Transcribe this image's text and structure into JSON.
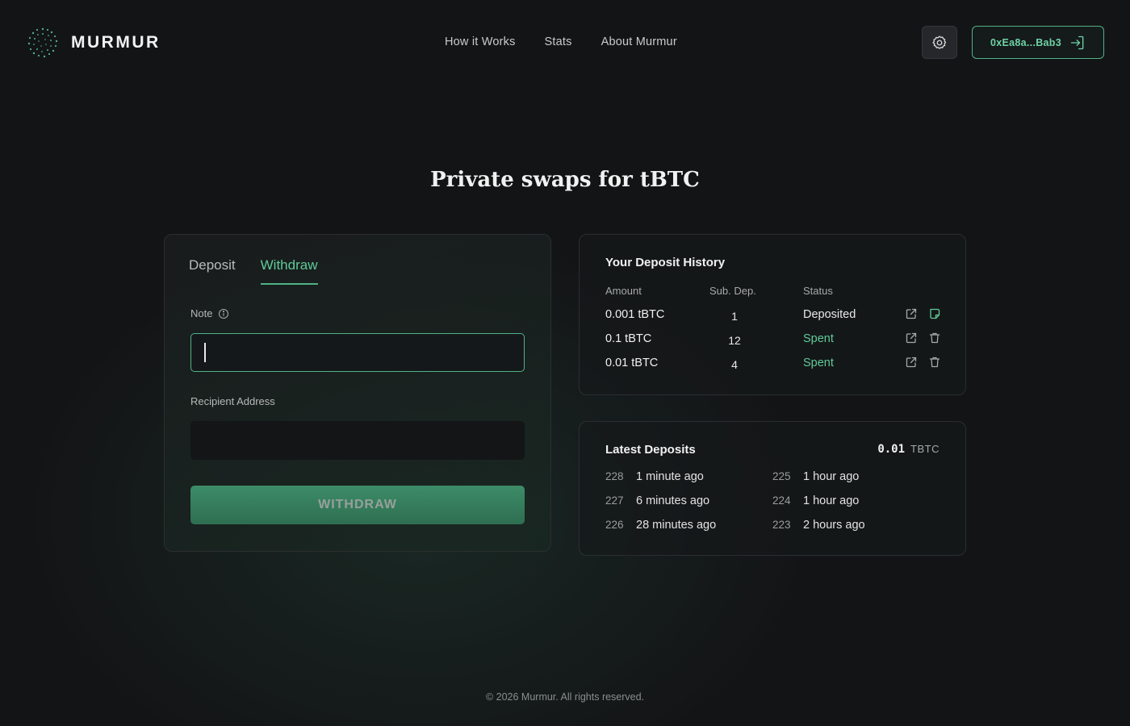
{
  "brand": {
    "name": "MURMUR"
  },
  "nav": {
    "items": [
      "How it Works",
      "Stats",
      "About Murmur"
    ]
  },
  "wallet": {
    "address": "0xEa8a...Bab3"
  },
  "hero": {
    "title": "Private swaps for tBTC"
  },
  "form": {
    "tabs": [
      "Deposit",
      "Withdraw"
    ],
    "active_tab": "Withdraw",
    "note_label": "Note",
    "note_value": "",
    "recipient_label": "Recipient Address",
    "recipient_value": "",
    "withdraw_label": "WITHDRAW"
  },
  "history": {
    "title": "Your Deposit History",
    "columns": [
      "Amount",
      "Sub. Dep.",
      "Status"
    ],
    "rows": [
      {
        "amount": "0.001 tBTC",
        "sub_dep": "1",
        "status": "Deposited"
      },
      {
        "amount": "0.1 tBTC",
        "sub_dep": "12",
        "status": "Spent"
      },
      {
        "amount": "0.01 tBTC",
        "sub_dep": "4",
        "status": "Spent"
      }
    ]
  },
  "latest": {
    "title": "Latest Deposits",
    "amount": "0.01",
    "unit": "TBTC",
    "items": [
      {
        "id": "228",
        "time": "1 minute ago"
      },
      {
        "id": "227",
        "time": "6 minutes ago"
      },
      {
        "id": "226",
        "time": "28 minutes ago"
      },
      {
        "id": "225",
        "time": "1 hour ago"
      },
      {
        "id": "224",
        "time": "1 hour ago"
      },
      {
        "id": "223",
        "time": "2 hours ago"
      }
    ]
  },
  "footer": {
    "text": "© 2026 Murmur. All rights reserved."
  },
  "colors": {
    "accent": "#4fb286",
    "accent_text": "#5fcb9a",
    "background": "#131416"
  }
}
